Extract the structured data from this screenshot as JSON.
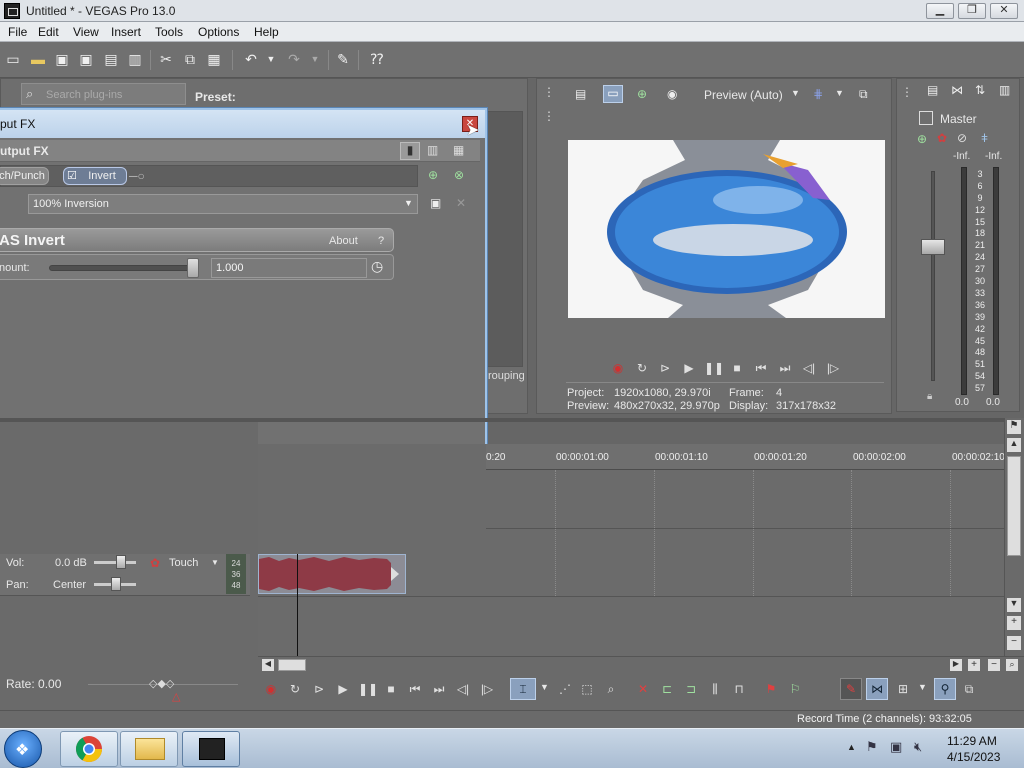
{
  "window": {
    "title": "Untitled * - VEGAS Pro 13.0",
    "minimize": "▁",
    "maximize": "❐",
    "close": "✕"
  },
  "menu": {
    "items": [
      "File",
      "Edit",
      "View",
      "Insert",
      "Tools",
      "Options",
      "Help"
    ]
  },
  "plugin_panel": {
    "search_placeholder": "Search plug-ins",
    "preset_label": "Preset:",
    "grouping_text": "rouping"
  },
  "fx_window": {
    "title": "put FX",
    "chain_title": "utput FX",
    "chain": [
      {
        "label": "ch/Punch",
        "checked": false
      },
      {
        "label": "Invert",
        "checked": true
      }
    ],
    "preset_value": "100% Inversion",
    "plugin_name": "AS Invert",
    "about_label": "About",
    "help_label": "?",
    "amount_label": "nount:",
    "amount_value": "1.000",
    "amount_fraction": 1.0
  },
  "preview": {
    "quality": "Preview (Auto)",
    "project_label": "Project:",
    "project_value": "1920x1080, 29.970i",
    "frame_label": "Frame:",
    "frame_value": "4",
    "preview_label": "Preview:",
    "preview_value": "480x270x32, 29.970p",
    "display_label": "Display:",
    "display_value": "317x178x32"
  },
  "master": {
    "label": "Master",
    "peak_left": "-Inf.",
    "peak_right": "-Inf.",
    "scale": [
      "3",
      "6",
      "9",
      "12",
      "15",
      "18",
      "21",
      "24",
      "27",
      "30",
      "33",
      "36",
      "39",
      "42",
      "45",
      "48",
      "51",
      "54",
      "57"
    ],
    "bottom_left": "0.0",
    "bottom_right": "0.0"
  },
  "timeline": {
    "ticks": [
      "0:20",
      "00:00:01:00",
      "00:00:01:10",
      "00:00:01:20",
      "00:00:02:00",
      "00:00:02:10"
    ]
  },
  "track": {
    "vol_label": "Vol:",
    "vol_value": "0.0 dB",
    "pan_label": "Pan:",
    "pan_value": "Center",
    "automation": "Touch",
    "meter_numbers": [
      "24",
      "36",
      "48"
    ]
  },
  "rate": {
    "label": "Rate: 0.00"
  },
  "status": {
    "record_time": "Record Time (2 channels): 93:32:05"
  },
  "taskbar": {
    "time": "11:29 AM",
    "date": "4/15/2023"
  },
  "colors": {
    "accent": "#9fc3e8",
    "record_red": "#d03030",
    "waveform": "#8e3a46"
  }
}
